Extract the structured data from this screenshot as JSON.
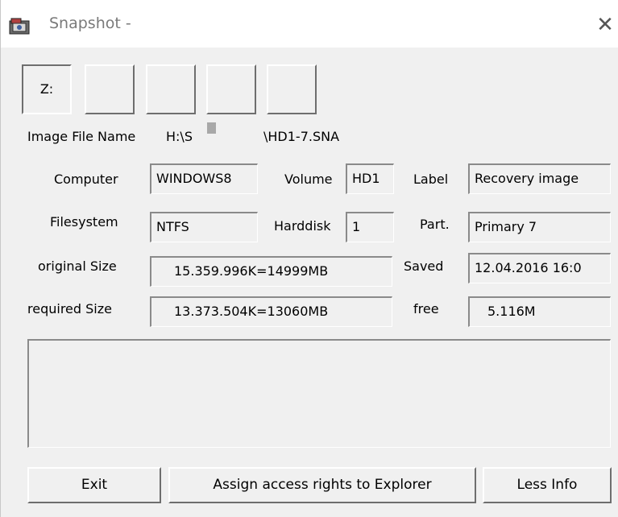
{
  "window": {
    "title": "Snapshot -",
    "icon": "snapshot-app-icon"
  },
  "drives": [
    {
      "label": "Z:",
      "selected": true
    },
    {
      "label": "",
      "selected": false
    },
    {
      "label": "",
      "selected": false
    },
    {
      "label": "",
      "selected": false
    },
    {
      "label": "",
      "selected": false
    }
  ],
  "image_file": {
    "label": "Image File Name",
    "path_prefix": "H:\\S",
    "path_suffix": "\\HD1-7.SNA"
  },
  "fields": {
    "computer": {
      "label": "Computer",
      "value": "WINDOWS8"
    },
    "volume": {
      "label": "Volume",
      "value": "HD1"
    },
    "label": {
      "label": "Label",
      "value": "Recovery image"
    },
    "filesystem": {
      "label": "Filesystem",
      "value": "NTFS"
    },
    "harddisk": {
      "label": "Harddisk",
      "value": "1"
    },
    "part": {
      "label": "Part.",
      "value": "Primary 7"
    },
    "original_size": {
      "label": "original Size",
      "value": "15.359.996K=14999MB"
    },
    "saved": {
      "label": "Saved",
      "value": "12.04.2016 16:0"
    },
    "required_size": {
      "label": "required Size",
      "value": "13.373.504K=13060MB"
    },
    "free": {
      "label": "free",
      "value": "5.116M"
    }
  },
  "buttons": {
    "exit": "Exit",
    "assign": "Assign access rights to Explorer",
    "less_info": "Less Info"
  },
  "icons": {
    "close": "close-icon",
    "app": "snapshot-app-icon"
  }
}
